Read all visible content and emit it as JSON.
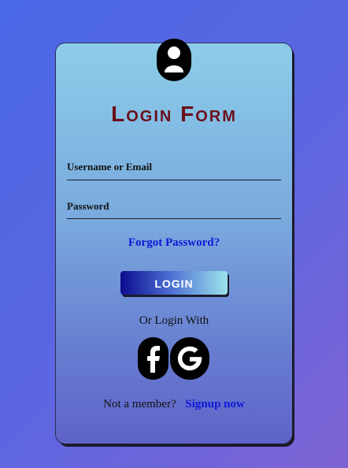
{
  "login_form": {
    "title": "Login Form",
    "avatar_icon": "user-icon",
    "username_placeholder": "Username or Email",
    "password_placeholder": "Password",
    "forgot_password": "Forgot Password?",
    "login_button": "LOGIN",
    "or_login_with": "Or Login With",
    "social": [
      {
        "name": "facebook-icon"
      },
      {
        "name": "google-icon"
      }
    ],
    "not_member": "Not a member?",
    "signup": "Signup now"
  },
  "colors": {
    "title": "#6b0f1a",
    "link": "#1018d8",
    "button_start": "#0d0c8e",
    "button_end": "#9ce3ec"
  }
}
